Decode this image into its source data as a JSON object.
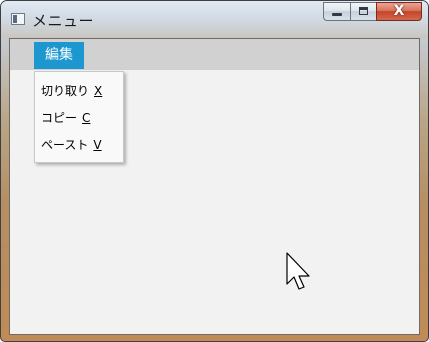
{
  "window": {
    "title": "メニュー",
    "icon": "app-window-icon",
    "caption_buttons": {
      "minimize": "minimize-icon",
      "maximize": "maximize-icon",
      "close": "close-icon",
      "close_glyph": "X"
    }
  },
  "menubar": {
    "items": [
      {
        "label": "編集",
        "state": "open"
      }
    ]
  },
  "dropdown": {
    "items": [
      {
        "label": "切り取り",
        "accelerator": "X"
      },
      {
        "label": "コピー",
        "accelerator": "C"
      },
      {
        "label": "ペースト",
        "accelerator": "V"
      }
    ]
  },
  "colors": {
    "menu_highlight": "#1c97cf",
    "menubar_bg": "#d1d1d1",
    "client_bg": "#f2f2f2"
  },
  "cursor": "arrow-cursor-icon"
}
